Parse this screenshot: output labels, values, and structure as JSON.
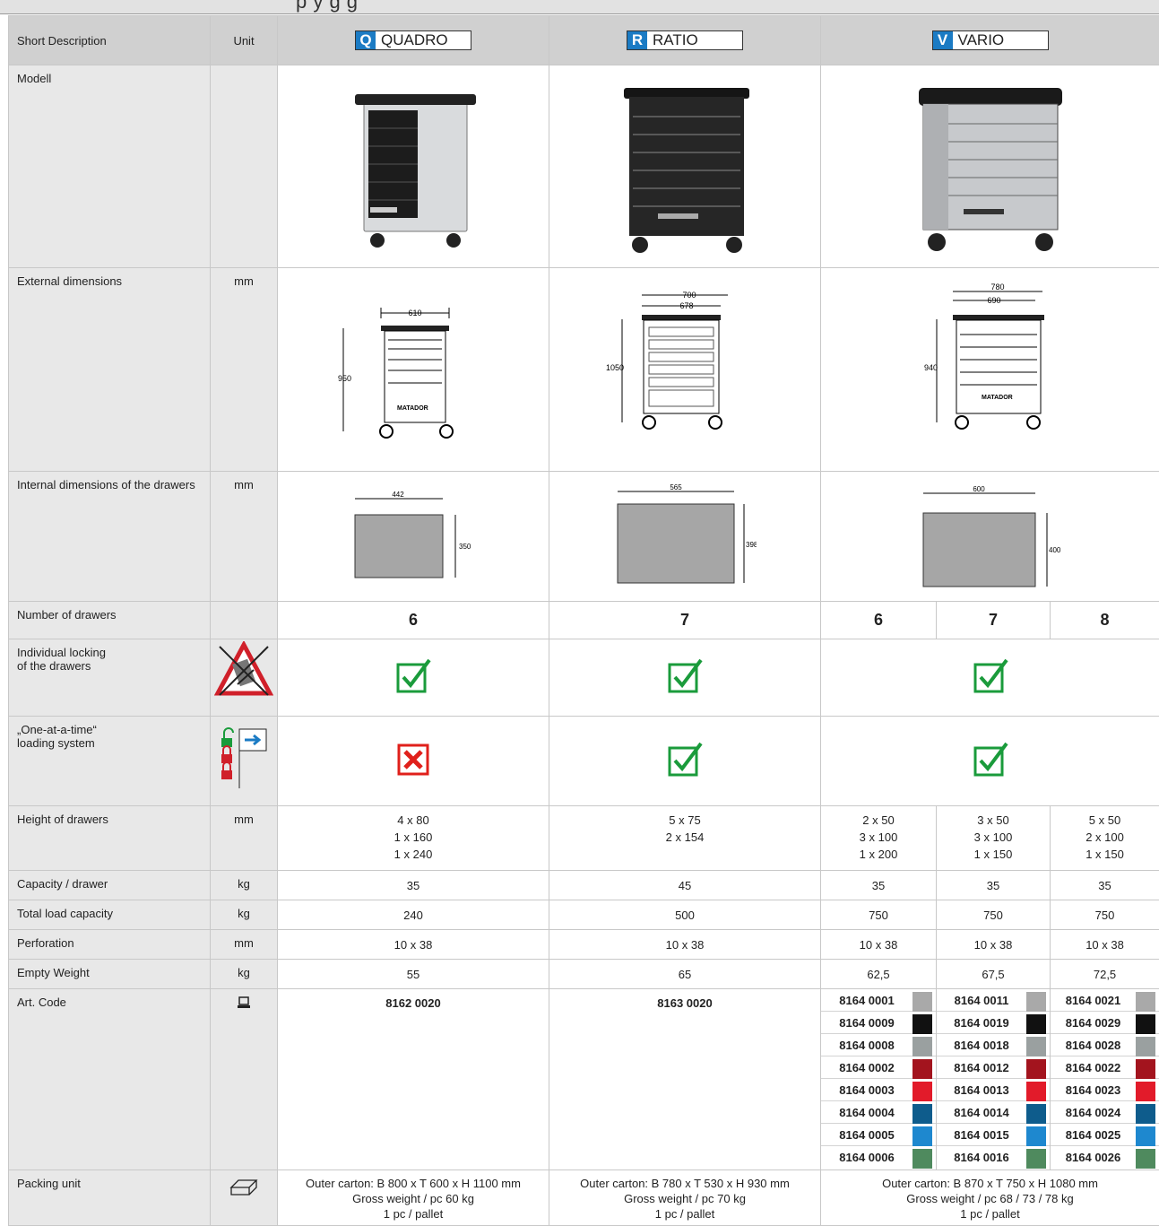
{
  "page_heading": "p y g g",
  "headers": {
    "short_description": "Short Description",
    "unit": "Unit",
    "products": [
      {
        "letter": "Q",
        "name": "QUADRO"
      },
      {
        "letter": "R",
        "name": "RATIO"
      },
      {
        "letter": "V",
        "name": "VARIO"
      }
    ]
  },
  "rows": {
    "modell": {
      "label": "Modell"
    },
    "external": {
      "label": "External dimensions",
      "unit": "mm",
      "quadro": {
        "width": "610",
        "height": "950",
        "brand": "MATADOR"
      },
      "ratio": {
        "width_outer": "700",
        "width_inner": "678",
        "height": "1050"
      },
      "vario": {
        "width_outer": "780",
        "width_inner": "690",
        "height": "940",
        "brand": "MATADOR"
      }
    },
    "internal": {
      "label": "Internal dimensions of the drawers",
      "unit": "mm",
      "quadro": {
        "w": "442",
        "h": "350"
      },
      "ratio": {
        "w": "565",
        "h": "398"
      },
      "vario": {
        "w": "600",
        "h": "400"
      }
    },
    "drawers": {
      "label": "Number of drawers",
      "values": [
        "6",
        "7",
        "6",
        "7",
        "8"
      ]
    },
    "locking": {
      "label": "Individual locking",
      "label2": "of the drawers"
    },
    "oneatatime": {
      "label": "„One-at-a-time“",
      "label2": "loading system"
    },
    "height": {
      "label": "Height of drawers",
      "unit": "mm",
      "values": [
        [
          "4 x 80",
          "1 x 160",
          "1 x 240"
        ],
        [
          "5 x 75",
          "2 x 154"
        ],
        [
          "2 x 50",
          "3 x 100",
          "1 x 200"
        ],
        [
          "3 x 50",
          "3 x 100",
          "1 x 150"
        ],
        [
          "5 x 50",
          "2 x 100",
          "1 x 150"
        ]
      ]
    },
    "capacity": {
      "label": "Capacity / drawer",
      "unit": "kg",
      "values": [
        "35",
        "45",
        "35",
        "35",
        "35"
      ]
    },
    "total": {
      "label": "Total load capacity",
      "unit": "kg",
      "values": [
        "240",
        "500",
        "750",
        "750",
        "750"
      ]
    },
    "perforation": {
      "label": "Perforation",
      "unit": "mm",
      "values": [
        "10 x 38",
        "10 x 38",
        "10 x 38",
        "10 x 38",
        "10 x 38"
      ]
    },
    "weight": {
      "label": "Empty Weight",
      "unit": "kg",
      "values": [
        "55",
        "65",
        "62,5",
        "67,5",
        "72,5"
      ]
    },
    "artcode": {
      "label": "Art. Code",
      "quadro": "8162 0020",
      "ratio": "8163 0020",
      "vario_cols": [
        [
          "8164 0001",
          "8164 0009",
          "8164 0008",
          "8164 0002",
          "8164 0003",
          "8164 0004",
          "8164 0005",
          "8164 0006"
        ],
        [
          "8164 0011",
          "8164 0019",
          "8164 0018",
          "8164 0012",
          "8164 0013",
          "8164 0014",
          "8164 0015",
          "8164 0016"
        ],
        [
          "8164 0021",
          "8164 0029",
          "8164 0028",
          "8164 0022",
          "8164 0023",
          "8164 0024",
          "8164 0025",
          "8164 0026"
        ]
      ],
      "swatch_colors": [
        "#a9a9a9",
        "#111111",
        "#9aa0a0",
        "#a3141e",
        "#e21b2a",
        "#0e5c8c",
        "#1e88cf",
        "#4f8a5e"
      ]
    },
    "packing": {
      "label": "Packing unit",
      "quadro": [
        "Outer carton: B 800 x T 600 x H 1100 mm",
        "Gross weight / pc 60 kg",
        "1 pc / pallet"
      ],
      "ratio": [
        "Outer carton: B 780 x T 530 x H 930 mm",
        "Gross weight / pc 70 kg",
        "1 pc / pallet"
      ],
      "vario": [
        "Outer carton: B 870 x T 750 x H 1080 mm",
        "Gross weight / pc 68 / 73 / 78 kg",
        "1 pc / pallet"
      ]
    }
  },
  "colors": {
    "check_green": "#1a9b3b",
    "cross_red": "#e0201b",
    "brand_blue": "#1b7bc4"
  }
}
